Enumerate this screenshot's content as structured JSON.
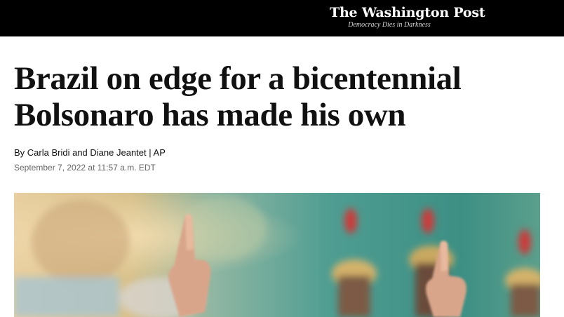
{
  "masthead": {
    "logo_text": "The Washington Post",
    "tagline": "Democracy Dies in Darkness"
  },
  "article": {
    "headline_line1": "Brazil on edge for a bicentennial",
    "headline_line2": "Bolsonaro has made his own",
    "byline_prefix": "By ",
    "author1": "Carla Bridi",
    "and": " and ",
    "author2": "Diane Jeantet",
    "separator": " | ",
    "source": "AP",
    "date": "September 7, 2022 at 11:57 a.m. EDT"
  },
  "colors": {
    "masthead_bg": "#000000",
    "headline": "#111111",
    "meta": "#666666"
  }
}
